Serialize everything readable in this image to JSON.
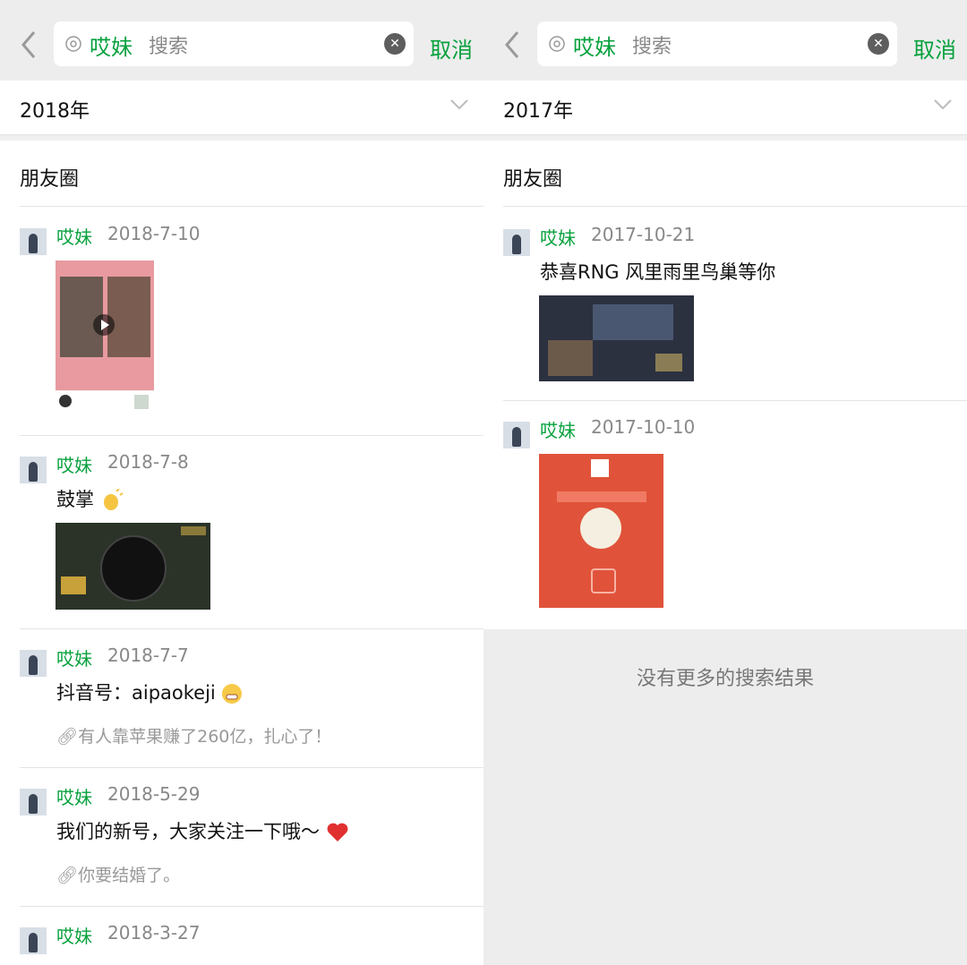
{
  "left": {
    "search": {
      "tag": "哎妹",
      "placeholder": "搜索",
      "cancel": "取消"
    },
    "year": "2018年",
    "section": "朋友圈",
    "posts": [
      {
        "author": "哎妹",
        "date": "2018-7-10"
      },
      {
        "author": "哎妹",
        "date": "2018-7-8",
        "text": "鼓掌"
      },
      {
        "author": "哎妹",
        "date": "2018-7-7",
        "text": "抖音号：aipaokeji",
        "link": "有人靠苹果赚了260亿，扎心了！"
      },
      {
        "author": "哎妹",
        "date": "2018-5-29",
        "text": "我们的新号，大家关注一下哦～",
        "link": "你要结婚了。"
      },
      {
        "author": "哎妹",
        "date": "2018-3-27"
      }
    ]
  },
  "right": {
    "search": {
      "tag": "哎妹",
      "placeholder": "搜索",
      "cancel": "取消"
    },
    "year": "2017年",
    "section": "朋友圈",
    "posts": [
      {
        "author": "哎妹",
        "date": "2017-10-21",
        "text": "恭喜RNG 风里雨里鸟巢等你"
      },
      {
        "author": "哎妹",
        "date": "2017-10-10"
      }
    ],
    "nomore": "没有更多的搜索结果"
  },
  "colors": {
    "accent": "#07a13d",
    "muted": "#888888",
    "background": "#ededed"
  },
  "icons": [
    "back-arrow-icon",
    "tag-icon",
    "clear-icon",
    "chevron-down-icon",
    "link-icon",
    "play-icon",
    "clap-emoji",
    "heart-emoji"
  ]
}
